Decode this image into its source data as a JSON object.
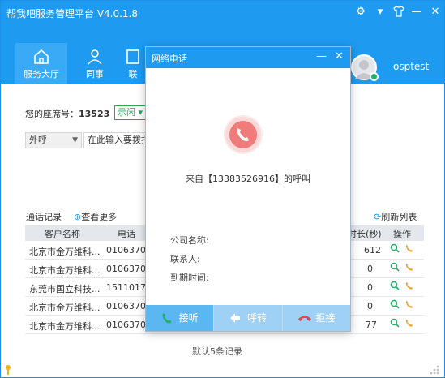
{
  "app": {
    "title": "帮我吧服务管理平台 V4.0.1.8",
    "username": "osptest"
  },
  "nav": {
    "items": [
      {
        "label": "服务大厅"
      },
      {
        "label": "同事"
      },
      {
        "label": "联"
      }
    ]
  },
  "seat": {
    "label": "您的座席号：",
    "number": "13523"
  },
  "status": {
    "value": "示闲"
  },
  "dial": {
    "type": "外呼",
    "placeholder": "在此输入要拨打"
  },
  "records": {
    "title": "通话记录",
    "more": "查看更多",
    "refresh": "刷新列表",
    "columns": [
      "客户名称",
      "电话",
      "时长(秒)",
      "操作"
    ],
    "rows": [
      {
        "name": "北京市金万维科...",
        "phone": "01063701",
        "duration": "612"
      },
      {
        "name": "北京市金万维科...",
        "phone": "01063701",
        "duration": "0"
      },
      {
        "name": "东莞市国立科技...",
        "phone": "15110172",
        "duration": "0"
      },
      {
        "name": "北京市金万维科...",
        "phone": "01063701",
        "duration": "0"
      },
      {
        "name": "北京市金万维科...",
        "phone": "01063701",
        "duration": "77"
      }
    ],
    "footer": "默认5条记录"
  },
  "modal": {
    "title": "网络电话",
    "caller": "来自【13383526916】的呼叫",
    "company_label": "公司名称:",
    "contact_label": "联系人:",
    "expire_label": "到期时间:",
    "answer": "接听",
    "transfer": "呼转",
    "reject": "拒接"
  },
  "colors": {
    "brand": "#1e9af0",
    "status_green": "#26a65b",
    "ring_red": "#f07b7b"
  }
}
